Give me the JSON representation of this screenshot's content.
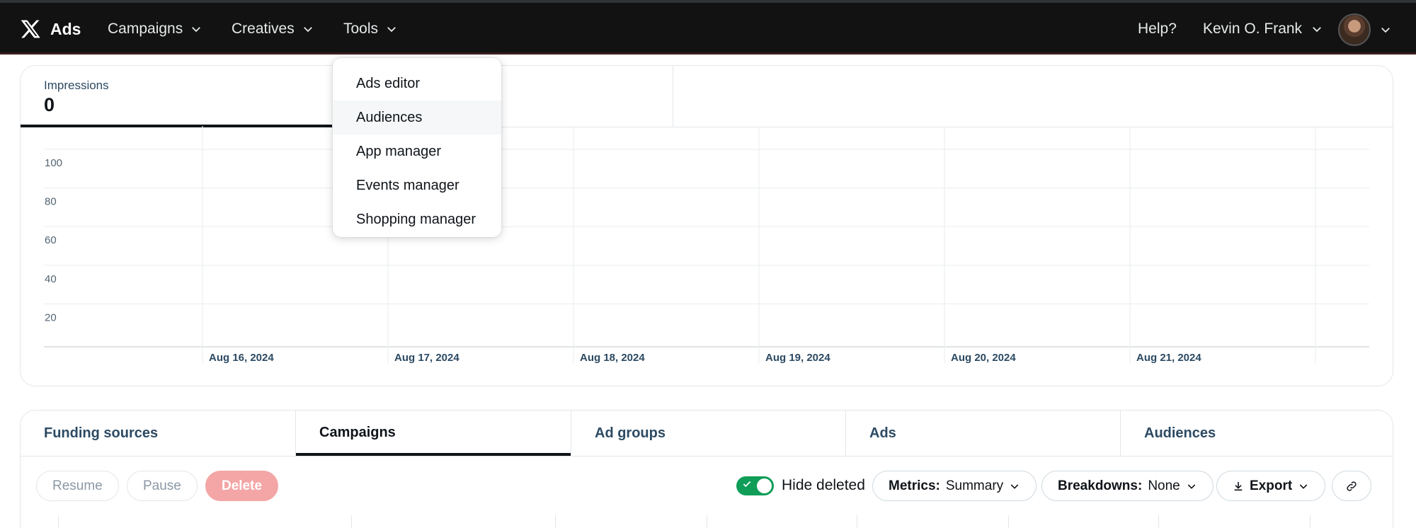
{
  "topbar": {
    "brand": "Ads",
    "nav": [
      {
        "label": "Campaigns"
      },
      {
        "label": "Creatives"
      },
      {
        "label": "Tools"
      }
    ],
    "help": "Help?",
    "user": "Kevin O. Frank"
  },
  "tools_menu": {
    "items": [
      "Ads editor",
      "Audiences",
      "App manager",
      "Events manager",
      "Shopping manager"
    ],
    "hovered": "Audiences"
  },
  "metric": {
    "label": "Impressions",
    "value": "0"
  },
  "chart_data": {
    "type": "line",
    "x": [
      "Aug 16, 2024",
      "Aug 17, 2024",
      "Aug 18, 2024",
      "Aug 19, 2024",
      "Aug 20, 2024",
      "Aug 21, 2024"
    ],
    "y_ticks": [
      "100",
      "80",
      "60",
      "40",
      "20"
    ],
    "ylim": [
      0,
      100
    ],
    "series": [],
    "grid": true
  },
  "entity_tabs": {
    "items": [
      "Funding sources",
      "Campaigns",
      "Ad groups",
      "Ads",
      "Audiences"
    ],
    "active": "Campaigns"
  },
  "actions": {
    "resume": "Resume",
    "pause": "Pause",
    "delete": "Delete"
  },
  "filters": {
    "hide_deleted_label": "Hide deleted",
    "hide_deleted_on": true,
    "metrics_key": "Metrics:",
    "metrics_value": "Summary",
    "breakdowns_key": "Breakdowns:",
    "breakdowns_value": "None",
    "export_label": "Export"
  },
  "colors": {
    "topbar": "#121212",
    "toggle_on": "#0f9d58",
    "delete": "#f4a6a6",
    "tab_text": "#2c4a63"
  }
}
